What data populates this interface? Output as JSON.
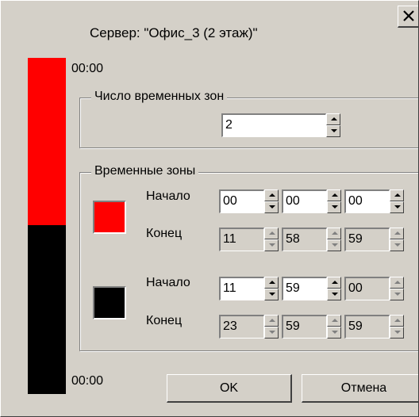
{
  "dialog": {
    "server_text": "Сервер:  \"Офис_3 (2 этаж)\"",
    "top_time": "00:00",
    "bottom_time": "00:00",
    "colors": {
      "zone1": "#ff0000",
      "zone2": "#000000",
      "background": "#d4d0c8"
    }
  },
  "zone_count": {
    "title": "Число временных зон",
    "value": "2"
  },
  "zones": {
    "title": "Временные зоны",
    "start_label": "Начало",
    "end_label": "Конец",
    "items": [
      {
        "start": [
          "00",
          "00",
          "00"
        ],
        "end": [
          "11",
          "58",
          "59"
        ]
      },
      {
        "start": [
          "11",
          "59",
          "00"
        ],
        "end": [
          "23",
          "59",
          "59"
        ]
      }
    ]
  },
  "buttons": {
    "ok": "OK",
    "cancel": "Отмена"
  }
}
